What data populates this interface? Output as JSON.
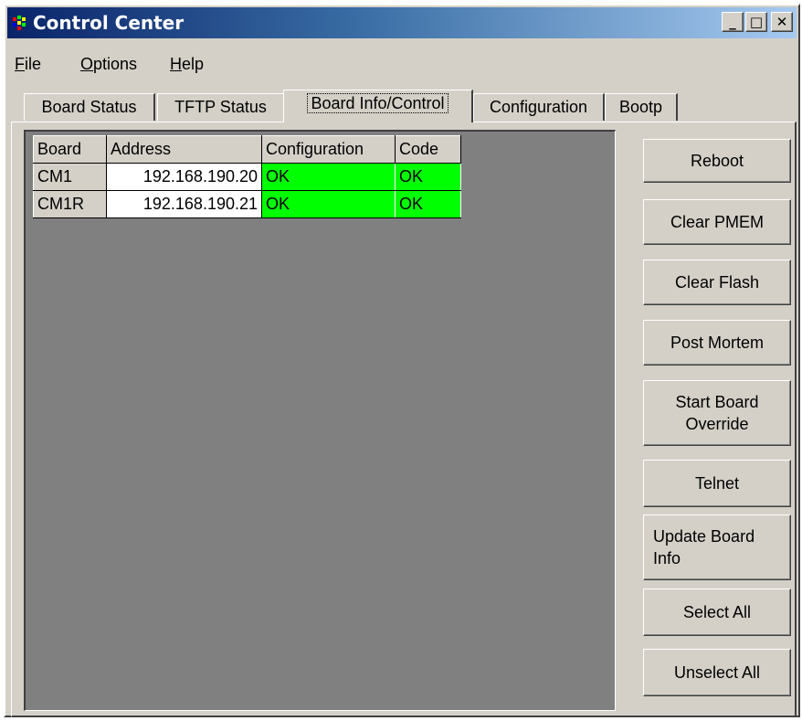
{
  "window": {
    "title": "Control Center",
    "controls": {
      "minimize": "_",
      "maximize": "□",
      "close": "✕"
    }
  },
  "menu": {
    "file": {
      "underline": "F",
      "rest": "ile"
    },
    "options": {
      "underline": "O",
      "rest": "ptions"
    },
    "help": {
      "underline": "H",
      "rest": "elp"
    }
  },
  "tabs": [
    {
      "label": "Board Status",
      "active": false
    },
    {
      "label": "TFTP Status",
      "active": false
    },
    {
      "label": "Board Info/Control",
      "active": true
    },
    {
      "label": "Configuration",
      "active": false
    },
    {
      "label": "Bootp",
      "active": false
    }
  ],
  "table": {
    "columns": [
      "Board",
      "Address",
      "Configuration",
      "Code"
    ],
    "rows": [
      {
        "board": "CM1",
        "address": "192.168.190.20",
        "configuration": "OK",
        "code": "OK"
      },
      {
        "board": "CM1R",
        "address": "192.168.190.21",
        "configuration": "OK",
        "code": "OK"
      }
    ]
  },
  "buttons": {
    "reboot": "Reboot",
    "clear_pmem": "Clear PMEM",
    "clear_flash": "Clear Flash",
    "post_mortem": "Post Mortem",
    "start_board_override_1": "Start Board",
    "start_board_override_2": "Override",
    "telnet": "Telnet",
    "update_board_info_1": "Update Board",
    "update_board_info_2": "Info",
    "select_all": "Select All",
    "unselect_all": "Unselect All"
  },
  "colors": {
    "titlebar_start": "#0a246a",
    "titlebar_end": "#a6caf0",
    "face": "#d4d0c8",
    "grid_background": "#808080",
    "status_ok": "#00ff00"
  },
  "icons": {
    "app": "control-center-app-icon"
  }
}
